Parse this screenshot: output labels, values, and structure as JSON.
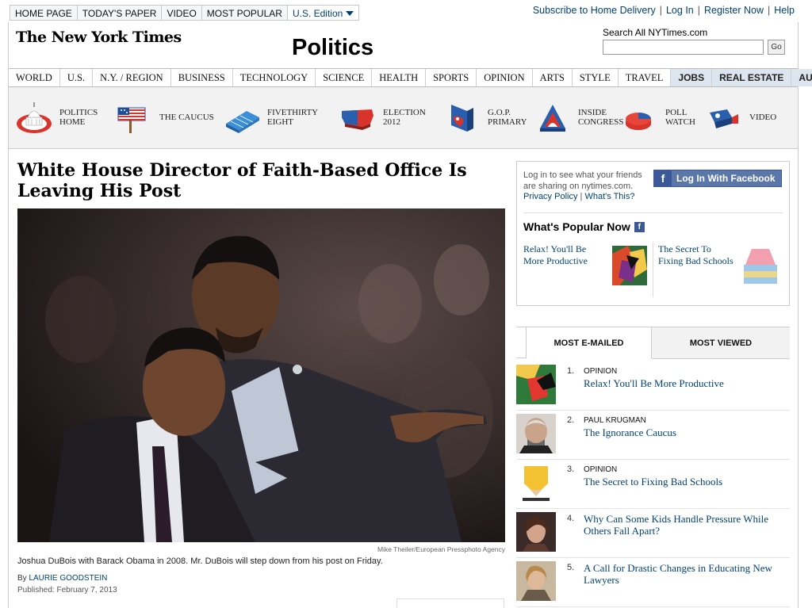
{
  "top_nav": [
    "HOME PAGE",
    "TODAY'S PAPER",
    "VIDEO",
    "MOST POPULAR"
  ],
  "edition": "U.S. Edition",
  "top_links": [
    "Subscribe to Home Delivery",
    "Log In",
    "Register Now",
    "Help"
  ],
  "masthead": {
    "logo": "The New York Times",
    "section": "Politics"
  },
  "search": {
    "label": "Search All NYTimes.com",
    "value": "",
    "button": "Go"
  },
  "section_nav": [
    "WORLD",
    "U.S.",
    "N.Y. / REGION",
    "BUSINESS",
    "TECHNOLOGY",
    "SCIENCE",
    "HEALTH",
    "SPORTS",
    "OPINION",
    "ARTS",
    "STYLE",
    "TRAVEL"
  ],
  "section_nav_highlight": [
    "JOBS",
    "REAL ESTATE",
    "AUTOS"
  ],
  "politics_nav": [
    {
      "line1": "POLITICS",
      "line2": "HOME",
      "icon": "capitol-icon"
    },
    {
      "line1": "THE CAUCUS",
      "line2": "",
      "icon": "flag-sign-icon"
    },
    {
      "line1": "FIVETHIRTY",
      "line2": "EIGHT",
      "icon": "bar-blocks-icon"
    },
    {
      "line1": "ELECTION",
      "line2": "2012",
      "icon": "us-map-icon"
    },
    {
      "line1": "G.O.P.",
      "line2": "PRIMARY",
      "icon": "gop-elephant-icon"
    },
    {
      "line1": "INSIDE",
      "line2": "CONGRESS",
      "icon": "capitol-dome-icon"
    },
    {
      "line1": "POLL",
      "line2": "WATCH",
      "icon": "pie-chart-icon"
    },
    {
      "line1": "VIDEO",
      "line2": "",
      "icon": "video-camera-icon"
    }
  ],
  "article": {
    "headline": "White House Director of Faith-Based Office Is Leaving His Post",
    "photo_credit": "Mike Theiler/European Pressphoto Agency",
    "caption": "Joshua DuBois with Barack Obama in 2008. Mr. DuBois will step down from his post on Friday.",
    "byline_prefix": "By",
    "author": "LAURIE GOODSTEIN",
    "published": "Published: February 7, 2013"
  },
  "facebook": {
    "text": "Log in to see what your friends are sharing on nytimes.com.",
    "privacy": "Privacy Policy",
    "whats_this": "What's This?",
    "button": "Log In With Facebook"
  },
  "popular_now": {
    "title": "What's Popular Now",
    "items": [
      "Relax! You'll Be More Productive",
      "The Secret To Fixing Bad Schools"
    ]
  },
  "most_tabs": {
    "active": "MOST E-MAILED",
    "inactive": "MOST VIEWED"
  },
  "most_emailed": [
    {
      "num": "1.",
      "kicker": "OPINION",
      "title": "Relax! You'll Be More Productive"
    },
    {
      "num": "2.",
      "kicker": "PAUL KRUGMAN",
      "title": "The Ignorance Caucus"
    },
    {
      "num": "3.",
      "kicker": "OPINION",
      "title": "The Secret to Fixing Bad Schools"
    },
    {
      "num": "4.",
      "kicker": "",
      "title": "Why Can Some Kids Handle Pressure While Others Fall Apart?"
    },
    {
      "num": "5.",
      "kicker": "",
      "title": "A Call for Drastic Changes in Educating New Lawyers"
    }
  ],
  "colors": {
    "link": "#004276",
    "facebook": "#3b5998",
    "nav_highlight": "#dde5ee"
  }
}
